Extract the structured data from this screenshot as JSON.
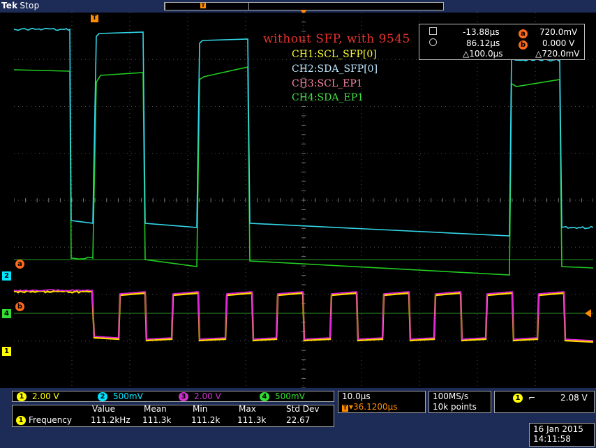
{
  "header": {
    "brand": "Tek",
    "status": "Stop",
    "trigger_marker": "T"
  },
  "annotations": {
    "title": "without SFP, with 9545",
    "channel_labels": [
      {
        "text": "CH1:SCL_SFP[0]",
        "color": "#ffff33"
      },
      {
        "text": "CH2:SDA_SFP[0]",
        "color": "#bfe8ff"
      },
      {
        "text": "CH3:SCL_EP1",
        "color": "#ff88aa"
      },
      {
        "text": "CH4:SDA_EP1",
        "color": "#44e044"
      }
    ]
  },
  "cursors": {
    "a_time": "-13.88µs",
    "a_label": "a",
    "a_value": "720.0mV",
    "b_time": "86.12µs",
    "b_label": "b",
    "b_value": "0.000 V",
    "delta_time": "△100.0µs",
    "delta_value": "△720.0mV"
  },
  "side_markers": {
    "ch2": "2",
    "ch4": "4",
    "ch1": "1",
    "cursor_a": "a",
    "cursor_b": "b"
  },
  "channel_settings": [
    {
      "num": "1",
      "scale": "2.00 V",
      "color": "#ffff00"
    },
    {
      "num": "2",
      "scale": "500mV",
      "color": "#00e5ff"
    },
    {
      "num": "3",
      "scale": "2.00 V",
      "color": "#cc33cc"
    },
    {
      "num": "4",
      "scale": "500mV",
      "color": "#33dd33"
    }
  ],
  "timebase": {
    "scale": "10.0µs",
    "trigger_pos": "▾36.1200µs",
    "trigger_icon": "T"
  },
  "acquisition": {
    "rate": "100MS/s",
    "points": "10k points"
  },
  "trigger": {
    "source": "1",
    "slope": "⌐",
    "level": "2.08 V"
  },
  "measurement": {
    "headers": [
      "Value",
      "Mean",
      "Min",
      "Max",
      "Std Dev"
    ],
    "source": "1",
    "name": "Frequency",
    "values": [
      "111.2kHz",
      "111.3k",
      "111.2k",
      "111.3k",
      "22.67"
    ]
  },
  "datetime": {
    "date": "16 Jan  2015",
    "time": "14:11:58"
  },
  "colors": {
    "ch1": "#ffd700",
    "ch2": "#33d6e8",
    "ch3": "#e020e0",
    "ch4": "#22cc22",
    "accent": "#ff8c00",
    "frame": "#1d2b57"
  }
}
